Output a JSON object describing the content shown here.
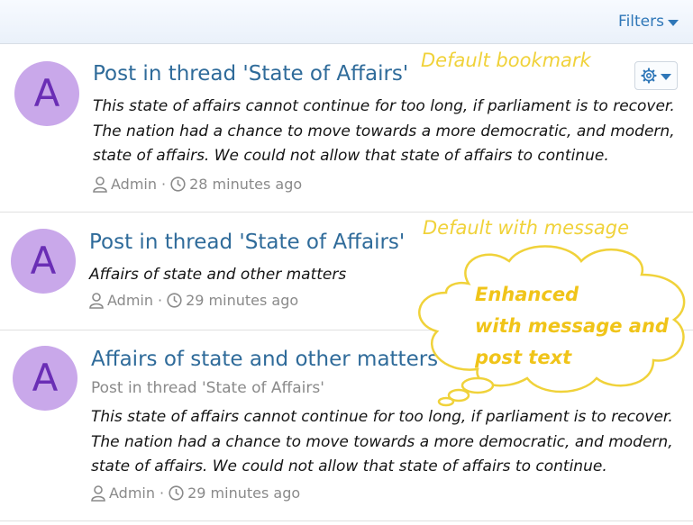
{
  "header": {
    "filters_label": "Filters"
  },
  "posts": [
    {
      "avatar_letter": "A",
      "title": "Post in thread 'State of Affairs'",
      "body": "This state of affairs cannot continue for too long, if parliament is to recover. The nation had a chance to move towards a more democratic, and modern, state of affairs. We could not allow that state of affairs to continue.",
      "author": "Admin",
      "time": "28 minutes ago"
    },
    {
      "avatar_letter": "A",
      "title": "Post in thread 'State of Affairs'",
      "body": "Affairs of state and other matters",
      "author": "Admin",
      "time": "29 minutes ago"
    },
    {
      "avatar_letter": "A",
      "title": "Affairs of state and other matters",
      "subtitle": "Post in thread 'State of Affairs'",
      "body": "This state of affairs cannot continue for too long, if parliament is to recover. The nation had a chance to move towards a more democratic, and modern, state of affairs. We could not allow that state of affairs to continue.",
      "author": "Admin",
      "time": "29 minutes ago"
    }
  ],
  "annotations": {
    "default_bookmark": "Default bookmark",
    "default_with_message": "Default with message",
    "enhanced_line1": "Enhanced",
    "enhanced_line2": "with message and",
    "enhanced_line3": "post text"
  },
  "meta_separator": "·",
  "icons": {
    "filters_caret": "caret-down-icon",
    "gear": "gear-icon",
    "user": "user-icon",
    "clock": "clock-icon"
  },
  "colors": {
    "link": "#2f6b9a",
    "avatar_bg": "#c9a8ea",
    "avatar_fg": "#6a2eb5",
    "annotation": "#f0d23a"
  }
}
